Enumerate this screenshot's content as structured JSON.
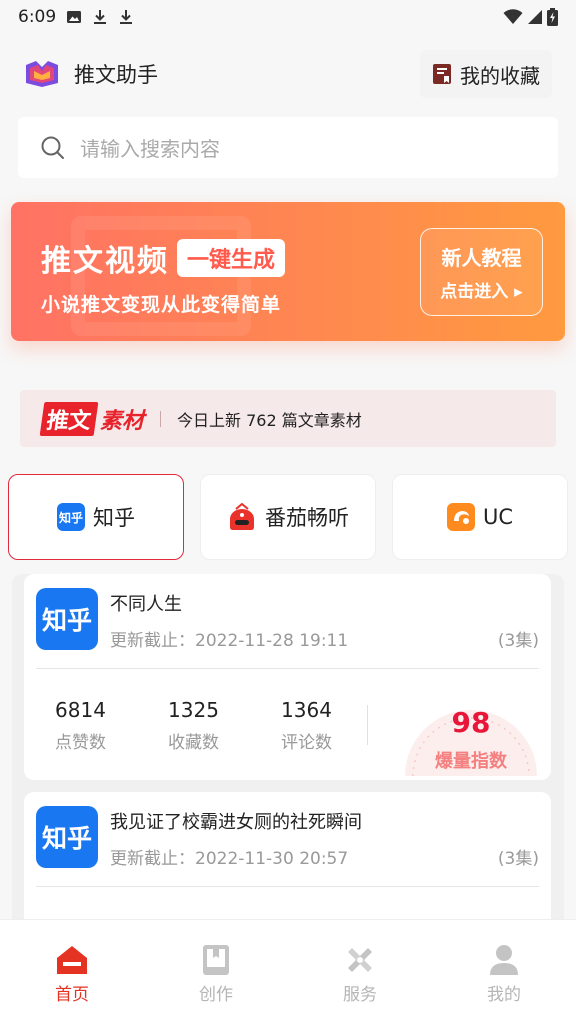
{
  "status_bar": {
    "time": "6:09"
  },
  "header": {
    "app_title": "推文助手",
    "favorites_label": "我的收藏"
  },
  "search": {
    "placeholder": "请输入搜索内容"
  },
  "banner": {
    "title": "推文视频",
    "badge": "一键生成",
    "subtitle": "小说推文变现从此变得简单",
    "cta_line1": "新人教程",
    "cta_line2": "点击进入"
  },
  "notice": {
    "logo_a": "推文",
    "logo_b": "素材",
    "text": "今日上新 762 篇文章素材"
  },
  "platforms": [
    {
      "label": "知乎",
      "icon_text": "知乎",
      "active": true
    },
    {
      "label": "番茄畅听",
      "active": false
    },
    {
      "label": "UC",
      "active": false
    }
  ],
  "articles": [
    {
      "logo_text": "知乎",
      "title": "不同人生",
      "updated": "更新截止：2022-11-28 19:11",
      "episodes": "(3集)",
      "stats": [
        {
          "value": "6814",
          "label": "点赞数"
        },
        {
          "value": "1325",
          "label": "收藏数"
        },
        {
          "value": "1364",
          "label": "评论数"
        }
      ],
      "score": "98",
      "score_label": "爆量指数"
    },
    {
      "logo_text": "知乎",
      "title": "我见证了校霸进女厕的社死瞬间",
      "updated": "更新截止：2022-11-30 20:57",
      "episodes": "(3集)"
    }
  ],
  "bottom_nav": [
    {
      "label": "首页",
      "active": true
    },
    {
      "label": "创作",
      "active": false
    },
    {
      "label": "服务",
      "active": false
    },
    {
      "label": "我的",
      "active": false
    }
  ],
  "colors": {
    "accent": "#e53323",
    "zhihu_blue": "#1a77f2",
    "banner_start": "#ff7264",
    "banner_end": "#ff9a3f"
  }
}
